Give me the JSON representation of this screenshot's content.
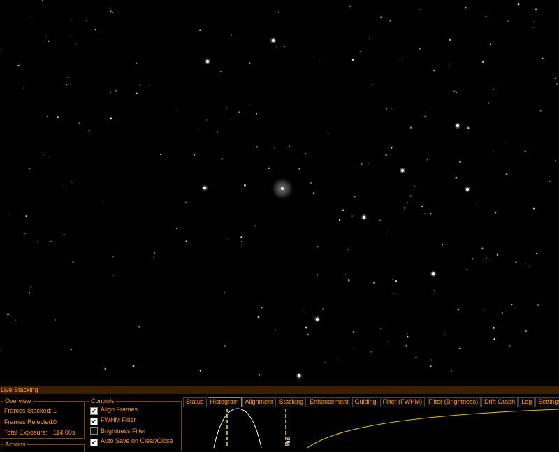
{
  "window": {
    "title": "Live Stacking"
  },
  "image_view": {
    "subject": "star-field",
    "background_color": "#000000",
    "star_color": "#ffffff"
  },
  "overview": {
    "title": "Overview",
    "rows": [
      {
        "label": "Frames Stacked:",
        "value": "1"
      },
      {
        "label": "Frames Rejected:",
        "value": "0"
      },
      {
        "label": "Total Exposure:",
        "value": "114,00s"
      }
    ]
  },
  "controls": {
    "title": "Controls",
    "items": [
      {
        "label": "Align Frames",
        "checked": true
      },
      {
        "label": "FWHM Filter",
        "checked": true
      },
      {
        "label": "Brightness Filter",
        "checked": false
      },
      {
        "label": "Auto Save on Clear/Close",
        "checked": true
      }
    ]
  },
  "actions": {
    "title": "Actions"
  },
  "tabs": [
    {
      "label": "Status",
      "active": false
    },
    {
      "label": "Histogram",
      "active": true
    },
    {
      "label": "Alignment",
      "active": false
    },
    {
      "label": "Stacking",
      "active": false
    },
    {
      "label": "Enhancement",
      "active": false
    },
    {
      "label": "Guiding",
      "active": false
    },
    {
      "label": "Filter (FWHM)",
      "active": false
    },
    {
      "label": "Filter (Brightness)",
      "active": false
    },
    {
      "label": "Drift Graph",
      "active": false
    },
    {
      "label": "Log",
      "active": false
    },
    {
      "label": "Settings",
      "active": false
    }
  ],
  "histogram": {
    "marker_label": "Mid",
    "curve_color": "#ffffff",
    "marker_color": "#f0e020",
    "stretch_curve_color": "#d8c800"
  },
  "colors": {
    "accent": "#ff9a1a",
    "titlebar_bg": "#3b1f00"
  }
}
